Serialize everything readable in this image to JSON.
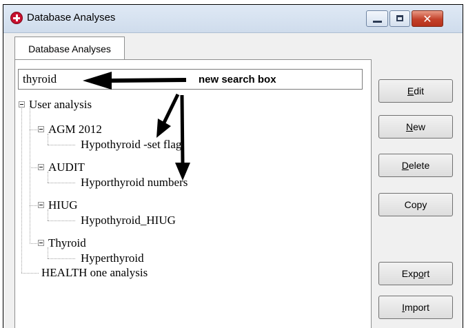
{
  "window": {
    "title": "Database Analyses",
    "icon": "red-cross-icon",
    "controls": [
      "minimize-icon",
      "maximize-icon",
      "close-icon"
    ],
    "close_glyph": "✕"
  },
  "tab": {
    "label": "Database Analyses"
  },
  "search": {
    "value": "thyroid"
  },
  "annotation": {
    "label": "new search box"
  },
  "tree": {
    "root1": "User analysis",
    "g1": "AGM 2012",
    "g1_child": "Hypothyroid -set flag",
    "g2": "AUDIT",
    "g2_child": "Hyporthyroid numbers",
    "g3": "HIUG",
    "g3_child": "Hypothyroid_HIUG",
    "g4": "Thyroid",
    "g4_child": "Hyperthyroid",
    "root2": "HEALTH one analysis"
  },
  "buttons": {
    "edit": {
      "pre": "",
      "key": "E",
      "post": "dit"
    },
    "new": {
      "pre": "",
      "key": "N",
      "post": "ew"
    },
    "delete": {
      "pre": "",
      "key": "D",
      "post": "elete"
    },
    "copy": {
      "label": "Copy"
    },
    "export": {
      "pre": "Exp",
      "key": "o",
      "post": "rt"
    },
    "import": {
      "pre": "",
      "key": "I",
      "post": "mport"
    }
  },
  "colors": {
    "close_button": "#c3412a",
    "app_icon": "#c8102e",
    "titlebar": "#dfe9f5"
  }
}
